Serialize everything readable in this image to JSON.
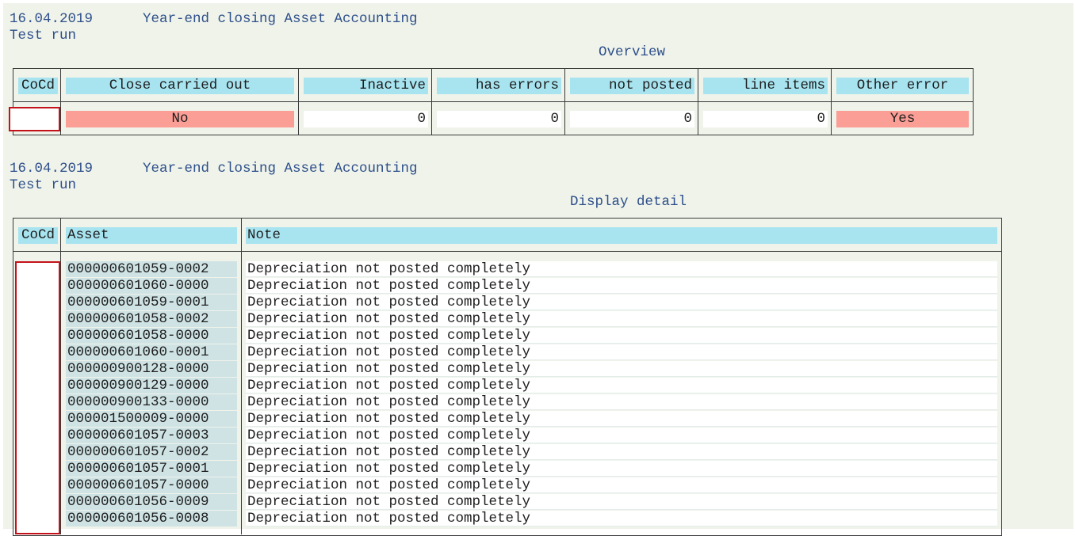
{
  "report1": {
    "date": "16.04.2019",
    "title": "Year-end closing Asset Accounting",
    "run_type": "Test run",
    "section": "Overview"
  },
  "overview": {
    "headers": [
      "CoCd",
      "Close carried out",
      "Inactive",
      "has errors",
      "not posted",
      "line items",
      "Other error"
    ],
    "row": {
      "cocd": "",
      "close_carried_out": "No",
      "inactive": "0",
      "has_errors": "0",
      "not_posted": "0",
      "line_items": "0",
      "other_error": "Yes"
    }
  },
  "report2": {
    "date": "16.04.2019",
    "title": "Year-end closing Asset Accounting",
    "run_type": "Test run",
    "section": "Display detail"
  },
  "detail": {
    "headers": [
      "CoCd",
      "Asset",
      "Note"
    ],
    "cocd": "",
    "rows": [
      {
        "asset": "000000601059-0002",
        "note": "Depreciation not posted completely"
      },
      {
        "asset": "000000601060-0000",
        "note": "Depreciation not posted completely"
      },
      {
        "asset": "000000601059-0001",
        "note": "Depreciation not posted completely"
      },
      {
        "asset": "000000601058-0002",
        "note": "Depreciation not posted completely"
      },
      {
        "asset": "000000601058-0000",
        "note": "Depreciation not posted completely"
      },
      {
        "asset": "000000601060-0001",
        "note": "Depreciation not posted completely"
      },
      {
        "asset": "000000900128-0000",
        "note": "Depreciation not posted completely"
      },
      {
        "asset": "000000900129-0000",
        "note": "Depreciation not posted completely"
      },
      {
        "asset": "000000900133-0000",
        "note": "Depreciation not posted completely"
      },
      {
        "asset": "000001500009-0000",
        "note": "Depreciation not posted completely"
      },
      {
        "asset": "000000601057-0003",
        "note": "Depreciation not posted completely"
      },
      {
        "asset": "000000601057-0002",
        "note": "Depreciation not posted completely"
      },
      {
        "asset": "000000601057-0001",
        "note": "Depreciation not posted completely"
      },
      {
        "asset": "000000601057-0000",
        "note": "Depreciation not posted completely"
      },
      {
        "asset": "000000601056-0009",
        "note": "Depreciation not posted completely"
      },
      {
        "asset": "000000601056-0008",
        "note": "Depreciation not posted completely"
      }
    ]
  },
  "colors": {
    "header_bg": "#a8e4f0",
    "error_bg": "#fa9e96",
    "asset_bg": "#cfe3e5",
    "page_bg": "#eff3ea",
    "title_text": "#2e4f8a",
    "selection_border": "#c4121a"
  }
}
